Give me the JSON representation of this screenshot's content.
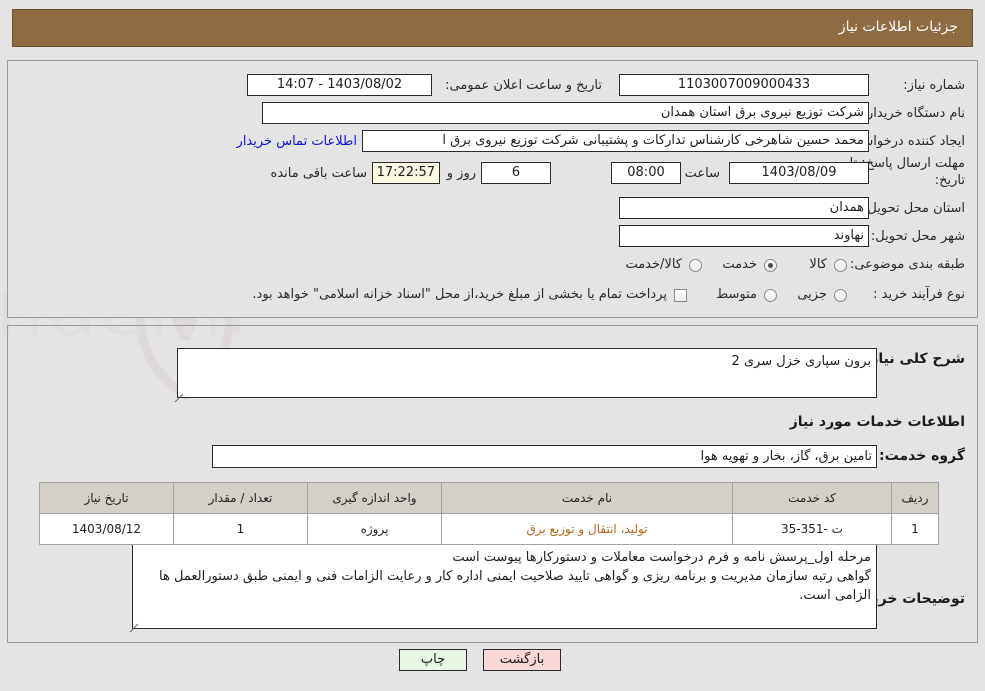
{
  "window": {
    "title": "جزئیات اطلاعات نیاز"
  },
  "summary": {
    "need_number_label": "شماره نیاز:",
    "need_number_value": "1103007009000433",
    "announce_label": "تاریخ و ساعت اعلان عمومی:",
    "announce_value": "1403/08/02 - 14:07",
    "buyer_org_label": "نام دستگاه خریدار:",
    "buyer_org_value": "شرکت توزیع نیروی برق استان همدان",
    "requester_label": "ایجاد کننده درخواست:",
    "requester_value": "محمد حسین شاهرخی کارشناس تدارکات و پشتیبانی شرکت توزیع نیروی برق ا",
    "contact_link": "اطلاعات تماس خریدار",
    "deadline_label": "مهلت ارسال پاسخ: تا تاریخ:",
    "deadline_date": "1403/08/09",
    "deadline_hour_label": "ساعت",
    "deadline_hour_value": "08:00",
    "days_value": "6",
    "days_label": "روز و",
    "remaining_time": "17:22:57",
    "remaining_label": "ساعت باقی مانده",
    "province_label": "استان محل تحویل:",
    "province_value": "همدان",
    "city_label": "شهر محل تحویل:",
    "city_value": "نهاوند",
    "category_label": "طبقه بندی موضوعی:",
    "category_options": [
      "کالا",
      "خدمت",
      "کالا/خدمت"
    ],
    "category_selected": "خدمت",
    "process_label": "نوع فرآیند خرید :",
    "process_options": [
      "جزیی",
      "متوسط"
    ],
    "process_selected": "",
    "treasury_checkbox_label": "پرداخت تمام یا بخشی از مبلغ خرید،از محل \"اسناد خزانه اسلامی\" خواهد بود.",
    "treasury_checked": false
  },
  "details": {
    "general_desc_label": "شرح کلی نیاز:",
    "general_desc_value": "برون سپاری خزل سری 2",
    "services_heading": "اطلاعات خدمات مورد نیاز",
    "service_group_label": "گروه خدمت:",
    "service_group_value": "تامین برق، گاز، بخار و تهویه هوا"
  },
  "table": {
    "headers": [
      "ردیف",
      "کد خدمت",
      "نام خدمت",
      "واحد اندازه گیری",
      "تعداد / مقدار",
      "تاریخ نیاز"
    ],
    "rows": [
      {
        "row": "1",
        "code": "ت -351-35",
        "name": "تولید، انتقال و توزیع برق",
        "unit": "پروژه",
        "qty": "1",
        "date": "1403/08/12"
      }
    ]
  },
  "buyer_notes": {
    "label": "توضیحات خریدار:",
    "value": "مرحله اول_پرسش نامه و فرم درخواست معاملات و دستورکارها پیوست است\nگواهی رتبه سازمان مدیریت و برنامه ریزی و گواهی تایید صلاحیت ایمنی اداره کار و رعایت الزامات فنی و ایمنی طبق دستورالعمل ها الزامی است."
  },
  "footer": {
    "print_label": "چاپ",
    "back_label": "بازگشت"
  },
  "colors": {
    "header_bg": "#8d6c42",
    "page_bg": "#e4e4e4",
    "link": "#1010e0",
    "service_text": "#b5651d",
    "print_btn": "#e8f6e4",
    "back_btn": "#fbd8d8"
  }
}
